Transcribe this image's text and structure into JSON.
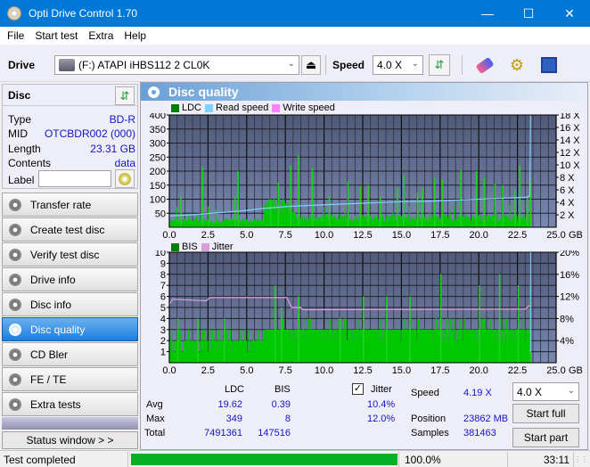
{
  "window": {
    "title": "Opti Drive Control 1.70",
    "minimize": "—",
    "maximize": "☐",
    "close": "✕"
  },
  "menu": [
    "File",
    "Start test",
    "Extra",
    "Help"
  ],
  "toolbar": {
    "drive_label": "Drive",
    "drive_value": "(F:)  ATAPI iHBS112  2 CL0K",
    "speed_label": "Speed",
    "speed_value": "4.0 X"
  },
  "disc": {
    "header": "Disc",
    "rows": [
      {
        "label": "Type",
        "value": "BD-R"
      },
      {
        "label": "MID",
        "value": "OTCBDR002 (000)"
      },
      {
        "label": "Length",
        "value": "23.31 GB"
      },
      {
        "label": "Contents",
        "value": "data"
      }
    ],
    "label_field": "Label",
    "label_value": ""
  },
  "nav": [
    {
      "label": "Transfer rate",
      "active": false
    },
    {
      "label": "Create test disc",
      "active": false
    },
    {
      "label": "Verify test disc",
      "active": false
    },
    {
      "label": "Drive info",
      "active": false
    },
    {
      "label": "Disc info",
      "active": false
    },
    {
      "label": "Disc quality",
      "active": true
    },
    {
      "label": "CD Bler",
      "active": false
    },
    {
      "label": "FE / TE",
      "active": false
    },
    {
      "label": "Extra tests",
      "active": false
    }
  ],
  "status_window": "Status window > >",
  "panel": {
    "title": "Disc quality"
  },
  "chart_data": [
    {
      "type": "area",
      "title": "LDC / Read speed",
      "legend": [
        "LDC",
        "Read speed",
        "Write speed"
      ],
      "legend_placement": "top-left",
      "colors": {
        "LDC": "#00c800",
        "Read speed": "#80d0ff",
        "Write speed": "#ff80ff"
      },
      "xlim": [
        0,
        25
      ],
      "xlabel": "GB",
      "xticks": [
        "0.0",
        "2.5",
        "5.0",
        "7.5",
        "10.0",
        "12.5",
        "15.0",
        "17.5",
        "20.0",
        "22.5",
        "25.0"
      ],
      "ylim": [
        0,
        400
      ],
      "yticks": [
        "50",
        "100",
        "150",
        "200",
        "250",
        "300",
        "350",
        "400"
      ],
      "y2ticks": [
        "2 X",
        "4 X",
        "6 X",
        "8 X",
        "10 X",
        "12 X",
        "14 X",
        "16 X",
        "18 X"
      ],
      "y2lim": [
        0,
        18
      ],
      "ldc_base": [
        [
          0,
          25
        ],
        [
          6,
          25
        ],
        [
          6.1,
          80
        ],
        [
          8,
          80
        ],
        [
          8.1,
          35
        ],
        [
          23.3,
          30
        ]
      ],
      "ldc_peaks": [
        [
          0.7,
          110
        ],
        [
          2.1,
          215
        ],
        [
          2.5,
          75
        ],
        [
          4.4,
          200
        ],
        [
          4.2,
          110
        ],
        [
          6.5,
          100
        ],
        [
          7.0,
          160
        ],
        [
          7.8,
          220
        ],
        [
          8.3,
          255
        ],
        [
          9.2,
          210
        ],
        [
          10.3,
          110
        ],
        [
          11.5,
          165
        ],
        [
          12.3,
          145
        ],
        [
          12.8,
          150
        ],
        [
          13.6,
          110
        ],
        [
          14.7,
          140
        ],
        [
          15.1,
          185
        ],
        [
          16.0,
          125
        ],
        [
          16.3,
          140
        ],
        [
          17.1,
          175
        ],
        [
          17.6,
          170
        ],
        [
          18.8,
          205
        ],
        [
          19.8,
          200
        ],
        [
          20.3,
          175
        ],
        [
          21.0,
          155
        ],
        [
          21.5,
          150
        ],
        [
          22.3,
          135
        ],
        [
          22.6,
          220
        ],
        [
          23.1,
          105
        ],
        [
          23.3,
          160
        ]
      ],
      "read_speed": [
        [
          0,
          1.8
        ],
        [
          1.5,
          2.0
        ],
        [
          3,
          2.3
        ],
        [
          5,
          2.7
        ],
        [
          6,
          3.0
        ],
        [
          7.5,
          3.3
        ],
        [
          9,
          3.5
        ],
        [
          11,
          3.7
        ],
        [
          13,
          3.9
        ],
        [
          15,
          4.1
        ],
        [
          17,
          4.2
        ],
        [
          19,
          4.4
        ],
        [
          21,
          4.6
        ],
        [
          23,
          4.8
        ],
        [
          23.3,
          5.0
        ],
        [
          23.35,
          18
        ]
      ]
    },
    {
      "type": "area",
      "title": "BIS / Jitter",
      "legend": [
        "BIS",
        "Jitter"
      ],
      "legend_placement": "top-left",
      "colors": {
        "BIS": "#00c800",
        "Jitter": "#e0a0e0"
      },
      "xlim": [
        0,
        25
      ],
      "xlabel": "GB",
      "xticks": [
        "0.0",
        "2.5",
        "5.0",
        "7.5",
        "10.0",
        "12.5",
        "15.0",
        "17.5",
        "20.0",
        "22.5",
        "25.0"
      ],
      "ylim": [
        0,
        10
      ],
      "yticks": [
        "1",
        "2",
        "3",
        "4",
        "5",
        "6",
        "7",
        "8",
        "9",
        "10"
      ],
      "y2ticks": [
        "4%",
        "8%",
        "12%",
        "16%",
        "20%"
      ],
      "y2lim": [
        0,
        20
      ],
      "bis_base": [
        [
          0,
          2
        ],
        [
          6,
          2
        ],
        [
          6.1,
          3
        ],
        [
          23.3,
          3
        ]
      ],
      "bis_peaks": [
        [
          0.5,
          4
        ],
        [
          1.8,
          4
        ],
        [
          3.5,
          4
        ],
        [
          6.8,
          7
        ],
        [
          7.2,
          5
        ],
        [
          8.3,
          6
        ],
        [
          11,
          4
        ],
        [
          12.5,
          6
        ],
        [
          14,
          6
        ],
        [
          15.5,
          6
        ],
        [
          17.5,
          8
        ],
        [
          20,
          7
        ],
        [
          21.3,
          8
        ],
        [
          22.5,
          7
        ],
        [
          23.3,
          7
        ]
      ],
      "jitter": [
        [
          0,
          10.5
        ],
        [
          0.2,
          11.5
        ],
        [
          2.4,
          11.2
        ],
        [
          2.6,
          11.8
        ],
        [
          7.6,
          11.8
        ],
        [
          7.9,
          10.0
        ],
        [
          8.5,
          10.0
        ],
        [
          8.6,
          9.6
        ],
        [
          23,
          9.7
        ],
        [
          23.3,
          10.4
        ]
      ]
    }
  ],
  "stats": {
    "col_ldc": "LDC",
    "col_bis": "BIS",
    "avg_label": "Avg",
    "max_label": "Max",
    "total_label": "Total",
    "ldc_avg": "19.62",
    "ldc_max": "349",
    "ldc_total": "7491361",
    "bis_avg": "0.39",
    "bis_max": "8",
    "bis_total": "147516",
    "jitter_label": "Jitter",
    "jitter_checked": true,
    "jitter_avg": "10.4%",
    "jitter_max": "12.0%",
    "speed_label": "Speed",
    "speed_value": "4.19 X",
    "position_label": "Position",
    "position_value": "23862 MB",
    "samples_label": "Samples",
    "samples_value": "381463",
    "speed_select": "4.0 X",
    "start_full": "Start full",
    "start_part": "Start part"
  },
  "statusbar": {
    "text": "Test completed",
    "progress": 1.0,
    "percent": "100.0%",
    "time": "33:11"
  }
}
